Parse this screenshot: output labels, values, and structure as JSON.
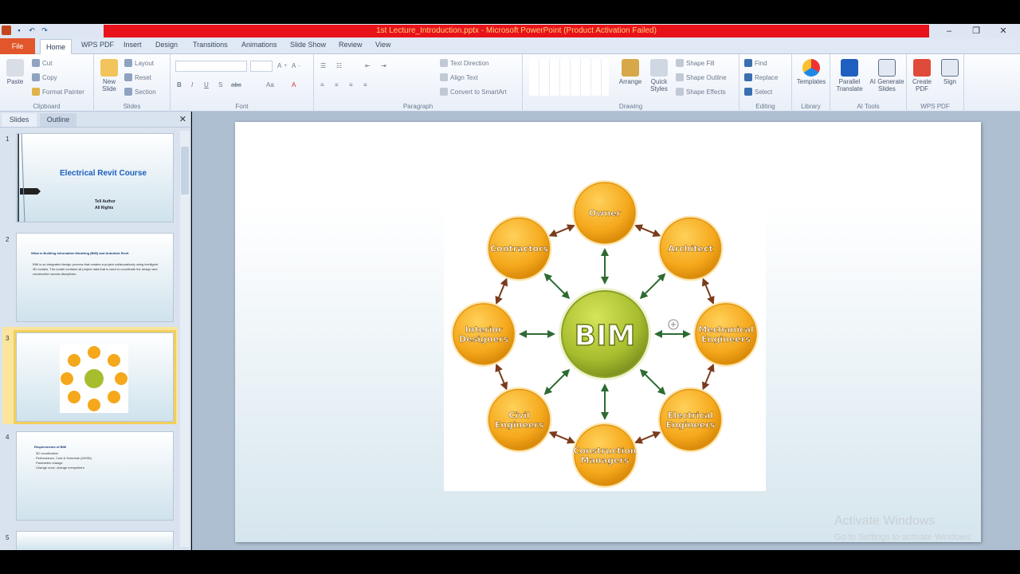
{
  "window": {
    "title": "1st Lecture_Introduction.pptx - Microsoft PowerPoint (Product Activation Failed)",
    "controls": {
      "minimize": "–",
      "restore": "❐",
      "close": "✕"
    }
  },
  "ribbon_tabs": [
    "File",
    "Home",
    "WPS PDF",
    "Insert",
    "Design",
    "Transitions",
    "Animations",
    "Slide Show",
    "Review",
    "View"
  ],
  "ribbon": {
    "clipboard": {
      "label": "Clipboard",
      "paste": "Paste",
      "cut": "Cut",
      "copy": "Copy",
      "format_painter": "Format Painter"
    },
    "slides": {
      "label": "Slides",
      "new_slide": "New Slide",
      "layout": "Layout",
      "reset": "Reset",
      "section": "Section"
    },
    "font": {
      "label": "Font",
      "bold": "B",
      "italic": "I",
      "underline": "U",
      "shadow": "S",
      "strike": "abc",
      "aa": "Aa"
    },
    "paragraph": {
      "label": "Paragraph",
      "text_direction": "Text Direction",
      "align_text": "Align Text",
      "convert_smartart": "Convert to SmartArt"
    },
    "drawing": {
      "label": "Drawing",
      "arrange": "Arrange",
      "quick_styles": "Quick Styles",
      "shape_fill": "Shape Fill",
      "shape_outline": "Shape Outline",
      "shape_effects": "Shape Effects"
    },
    "editing": {
      "label": "Editing",
      "find": "Find",
      "replace": "Replace",
      "select": "Select"
    },
    "library": {
      "label": "Library",
      "templates": "Templates"
    },
    "ai_tools": {
      "label": "AI Tools",
      "parallel_translate": "Parallel Translate",
      "ai_generate_slides": "AI Generate Slides"
    },
    "wps_pdf": {
      "label": "WPS PDF",
      "create_pdf": "Create PDF",
      "sign": "Sign"
    }
  },
  "pane": {
    "tabs": [
      "Slides",
      "Outline"
    ],
    "close": "✕",
    "thumbs": [
      {
        "num": "1",
        "title": "Electrical Revit Course",
        "sub1": "Tell Author",
        "sub2": "All Rights"
      },
      {
        "num": "2",
        "title": "What is Building Information Modeling (BIM) and Autodesk Revit",
        "body": "BIM is an integrated design process that creates a project collaboratively using intelligent 3D models. The model contains all project data that is used to coordinate the design and construction across disciplines."
      },
      {
        "num": "3"
      },
      {
        "num": "4",
        "title": "Requirements of BIM",
        "lines": [
          "3D coordination",
          "Performance, Cost & Schedule (4D/5D)",
          "Parametric change",
          "Change once, change everywhere"
        ]
      },
      {
        "num": "5"
      }
    ]
  },
  "diagram": {
    "center": "BIM",
    "nodes": [
      {
        "id": "owner",
        "lines": [
          "Owner"
        ]
      },
      {
        "id": "architect",
        "lines": [
          "Architect"
        ]
      },
      {
        "id": "mechanical",
        "lines": [
          "Mechanical",
          "Engineers"
        ]
      },
      {
        "id": "electrical",
        "lines": [
          "Electrical",
          "Engineers"
        ]
      },
      {
        "id": "construction",
        "lines": [
          "Construction",
          "Managers"
        ]
      },
      {
        "id": "civil",
        "lines": [
          "Civil",
          "Engineers"
        ]
      },
      {
        "id": "interior",
        "lines": [
          "Interior",
          "Designers"
        ]
      },
      {
        "id": "contractors",
        "lines": [
          "Contractors"
        ]
      }
    ],
    "colors": {
      "node": "#f5a81c",
      "center": "#a8bd2e",
      "arrow": "#2e6b32",
      "ring_arrow": "#7a3b1c",
      "text": "#ffffff"
    }
  },
  "activation": {
    "line1": "Activate Windows",
    "line2": "Go to Settings to activate Windows."
  }
}
